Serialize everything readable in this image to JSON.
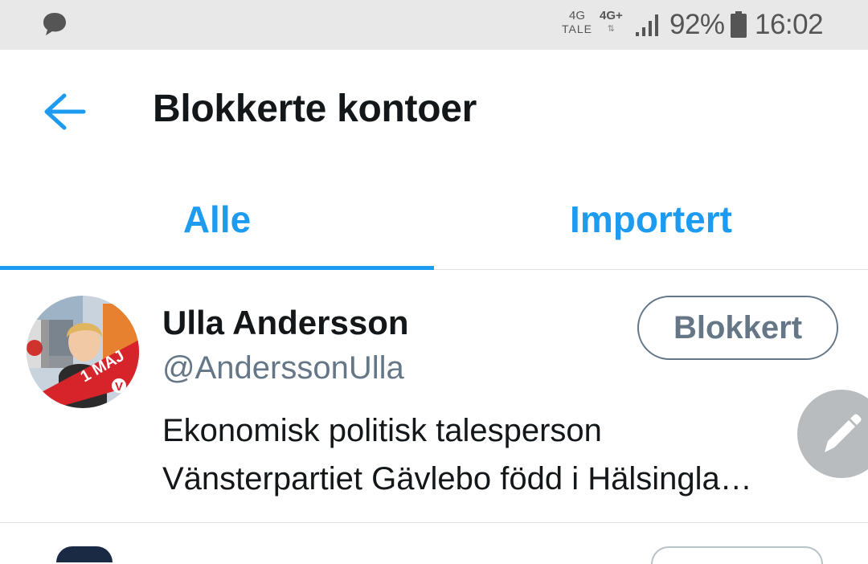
{
  "status_bar": {
    "network_primary": "4G",
    "network_primary_sub": "TALE",
    "network_secondary": "4G+",
    "network_secondary_sub": "⇅",
    "battery_percent": "92%",
    "time": "16:02",
    "icons": [
      "message-icon",
      "signal-icon",
      "battery-icon"
    ]
  },
  "header": {
    "back_icon": "back-arrow-icon",
    "title": "Blokkerte kontoer"
  },
  "tabs": [
    {
      "label": "Alle",
      "selected": true
    },
    {
      "label": "Importert",
      "selected": false
    }
  ],
  "accounts": [
    {
      "display_name": "Ulla Andersson",
      "handle": "@AnderssonUlla",
      "bio_line1": "Ekonomisk politisk talesperson",
      "bio_line2": "Vänsterpartiet Gävlebo född i Hälsingla…",
      "button_label": "Blokkert",
      "avatar_badge_text": "1 MAJ",
      "avatar_badge_letter": "V"
    }
  ],
  "fab": {
    "icon": "pen-icon"
  },
  "colors": {
    "accent": "#1d9bf0",
    "text_primary": "#14171a",
    "text_secondary": "#657786",
    "status_bar_bg": "#e8e8e8",
    "fab_bg": "#b8bcbf"
  }
}
